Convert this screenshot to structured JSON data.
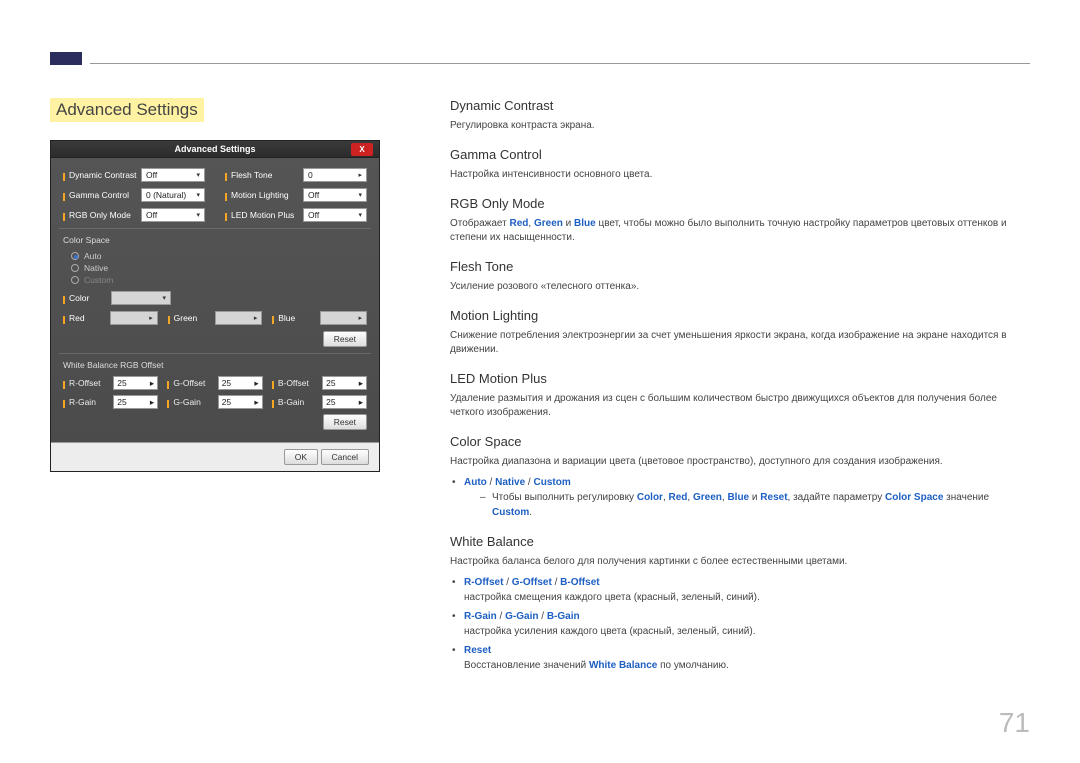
{
  "page_title": "Advanced Settings",
  "page_number": "71",
  "panel": {
    "title": "Advanced Settings",
    "close": "X",
    "rows": [
      {
        "l1": "Dynamic Contrast",
        "v1": "Off",
        "l2": "Flesh Tone",
        "v2": "0"
      },
      {
        "l1": "Gamma Control",
        "v1": "0 (Natural)",
        "l2": "Motion Lighting",
        "v2": "Off"
      },
      {
        "l1": "RGB Only Mode",
        "v1": "Off",
        "l2": "LED Motion Plus",
        "v2": "Off"
      }
    ],
    "color_space_title": "Color Space",
    "radio_auto": "Auto",
    "radio_native": "Native",
    "radio_custom": "Custom",
    "pickers": [
      {
        "label": "Color",
        "value": ""
      },
      {
        "label": "Red",
        "value": ""
      },
      {
        "label": "Green",
        "value": ""
      },
      {
        "label": "Blue",
        "value": ""
      }
    ],
    "reset": "Reset",
    "wb_title": "White Balance RGB Offset",
    "wb_rows": [
      {
        "a": "R-Offset",
        "av": "25",
        "b": "G-Offset",
        "bv": "25",
        "c": "B-Offset",
        "cv": "25"
      },
      {
        "a": "R-Gain",
        "av": "25",
        "b": "G-Gain",
        "bv": "25",
        "c": "B-Gain",
        "cv": "25"
      }
    ],
    "ok": "OK",
    "cancel": "Cancel"
  },
  "desc": {
    "dynamic_contrast_h": "Dynamic Contrast",
    "dynamic_contrast_p": "Регулировка контраста экрана.",
    "gamma_h": "Gamma Control",
    "gamma_p": "Настройка интенсивности основного цвета.",
    "rgb_h": "RGB Only Mode",
    "rgb_p_pre": "Отображает ",
    "rgb_red": "Red",
    "rgb_comma1": ", ",
    "rgb_green": "Green",
    "rgb_sep": " и ",
    "rgb_blue": "Blue",
    "rgb_p_post": " цвет, чтобы можно было выполнить точную настройку параметров цветовых оттенков и степени их насыщенности.",
    "flesh_h": "Flesh Tone",
    "flesh_p": "Усиление розового «телесного оттенка».",
    "motion_h": "Motion Lighting",
    "motion_p": "Снижение потребления электроэнергии за счет уменьшения яркости экрана, когда изображение на экране находится в движении.",
    "led_h": "LED Motion Plus",
    "led_p": "Удаление размытия и дрожания из сцен с большим количеством быстро движущихся объектов для получения более четкого изображения.",
    "cs_h": "Color Space",
    "cs_p": "Настройка диапазона и вариации цвета (цветовое пространство), доступного для создания изображения.",
    "cs_li_auto": "Auto",
    "cs_li_sep": " / ",
    "cs_li_native": "Native",
    "cs_li_custom": "Custom",
    "cs_sub_pre": "Чтобы выполнить регулировку ",
    "cs_sub_color": "Color",
    "cs_c": ", ",
    "cs_sub_red": "Red",
    "cs_sub_green": "Green",
    "cs_sub_blue": "Blue",
    "cs_sub_and": " и ",
    "cs_sub_reset": "Reset",
    "cs_sub_mid": ", задайте параметру ",
    "cs_sub_cs": "Color Space",
    "cs_sub_post_pre": " значение ",
    "cs_sub_custom": "Custom",
    "cs_sub_dot": ".",
    "wb_h": "White Balance",
    "wb_p": "Настройка баланса белого для получения картинки с более естественными цветами.",
    "wb_li1_a": "R-Offset",
    "wb_li1_b": "G-Offset",
    "wb_li1_c": "B-Offset",
    "wb_li1_p": "настройка смещения каждого цвета (красный, зеленый, синий).",
    "wb_li2_a": "R-Gain",
    "wb_li2_b": "G-Gain",
    "wb_li2_c": "B-Gain",
    "wb_li2_p": "настройка усиления каждого цвета (красный, зеленый, синий).",
    "wb_li3": "Reset",
    "wb_li3_pre": "Восстановление значений ",
    "wb_li3_wb": "White Balance",
    "wb_li3_post": " по умолчанию."
  }
}
